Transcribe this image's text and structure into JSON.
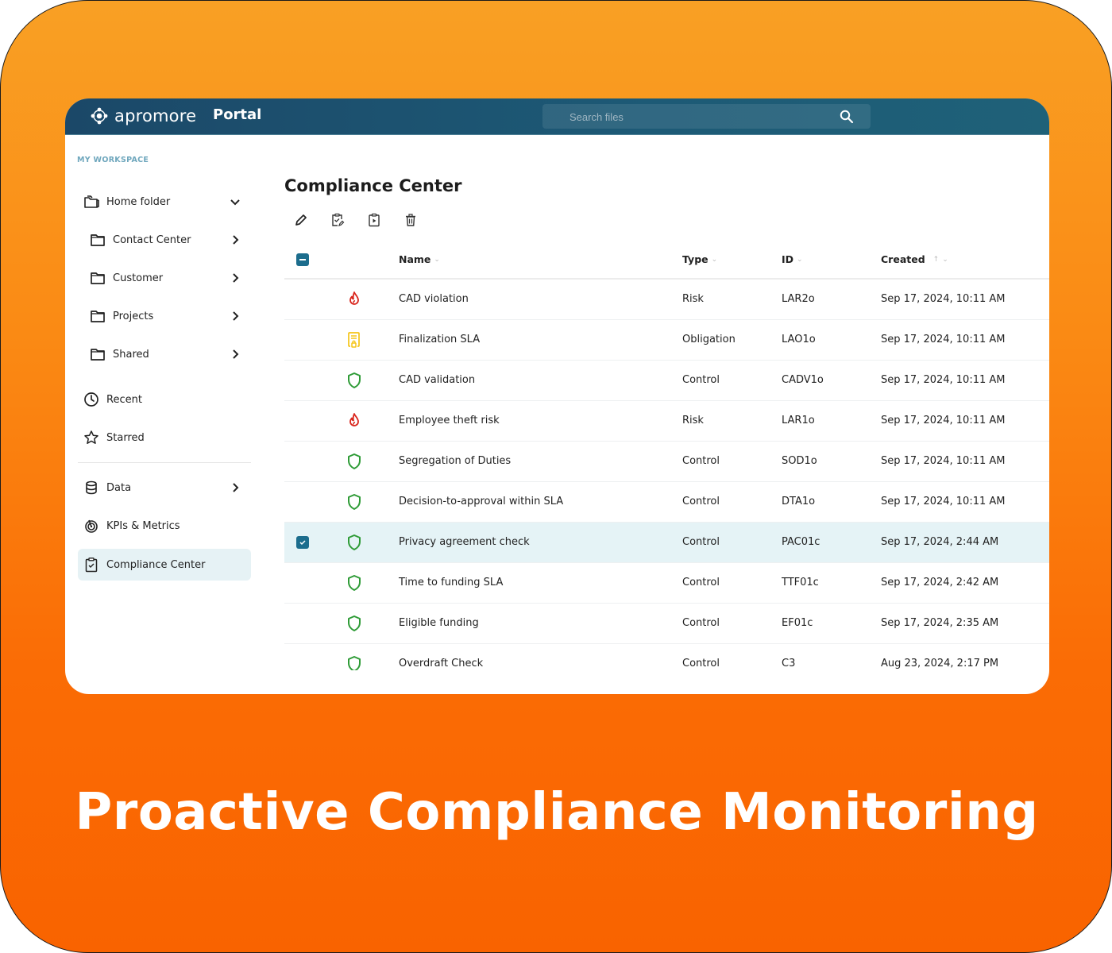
{
  "app": {
    "brand": "apromore",
    "product": "Portal",
    "search_placeholder": "Search files"
  },
  "sidebar": {
    "section_label": "MY WORKSPACE",
    "items": [
      {
        "label": "Home folder",
        "icon": "folder-open-icon",
        "chevron": "down"
      },
      {
        "label": "Contact Center",
        "icon": "folder-icon",
        "chevron": "right"
      },
      {
        "label": "Customer",
        "icon": "folder-icon",
        "chevron": "right"
      },
      {
        "label": "Projects",
        "icon": "folder-icon",
        "chevron": "right"
      },
      {
        "label": "Shared",
        "icon": "folder-icon",
        "chevron": "right"
      },
      {
        "label": "Recent",
        "icon": "clock-icon"
      },
      {
        "label": "Starred",
        "icon": "star-icon"
      },
      {
        "label": "Data",
        "icon": "database-icon",
        "chevron": "right"
      },
      {
        "label": "KPIs & Metrics",
        "icon": "target-icon"
      },
      {
        "label": "Compliance Center",
        "icon": "clipboard-check-icon",
        "active": true
      }
    ]
  },
  "main": {
    "title": "Compliance Center",
    "toolbar": [
      "edit",
      "validate",
      "run",
      "delete"
    ],
    "columns": {
      "name": "Name",
      "type": "Type",
      "id": "ID",
      "created": "Created"
    },
    "rows": [
      {
        "kind": "risk",
        "name": "CAD violation",
        "type": "Risk",
        "id": "LAR2o",
        "created": "Sep 17, 2024, 10:11 AM",
        "selected": false
      },
      {
        "kind": "obligation",
        "name": "Finalization SLA",
        "type": "Obligation",
        "id": "LAO1o",
        "created": "Sep 17, 2024, 10:11 AM",
        "selected": false
      },
      {
        "kind": "control",
        "name": "CAD validation",
        "type": "Control",
        "id": "CADV1o",
        "created": "Sep 17, 2024, 10:11 AM",
        "selected": false
      },
      {
        "kind": "risk",
        "name": "Employee theft risk",
        "type": "Risk",
        "id": "LAR1o",
        "created": "Sep 17, 2024, 10:11 AM",
        "selected": false
      },
      {
        "kind": "control",
        "name": "Segregation of Duties",
        "type": "Control",
        "id": "SOD1o",
        "created": "Sep 17, 2024, 10:11 AM",
        "selected": false
      },
      {
        "kind": "control",
        "name": "Decision-to-approval within SLA",
        "type": "Control",
        "id": "DTA1o",
        "created": "Sep 17, 2024, 10:11 AM",
        "selected": false
      },
      {
        "kind": "control",
        "name": "Privacy agreement check",
        "type": "Control",
        "id": "PAC01c",
        "created": "Sep 17, 2024, 2:44 AM",
        "selected": true
      },
      {
        "kind": "control",
        "name": "Time to funding SLA",
        "type": "Control",
        "id": "TTF01c",
        "created": "Sep 17, 2024, 2:42 AM",
        "selected": false
      },
      {
        "kind": "control",
        "name": "Eligible funding",
        "type": "Control",
        "id": "EF01c",
        "created": "Sep 17, 2024, 2:35 AM",
        "selected": false
      },
      {
        "kind": "control",
        "name": "Overdraft Check",
        "type": "Control",
        "id": "C3",
        "created": "Aug 23, 2024, 2:17 PM",
        "selected": false
      }
    ]
  },
  "colors": {
    "risk": "#d9251c",
    "obligation": "#f5c518",
    "control": "#2e9b36",
    "accent": "#1c6d8d",
    "topbar": "#1b4868"
  },
  "headline": "Proactive Compliance Monitoring"
}
